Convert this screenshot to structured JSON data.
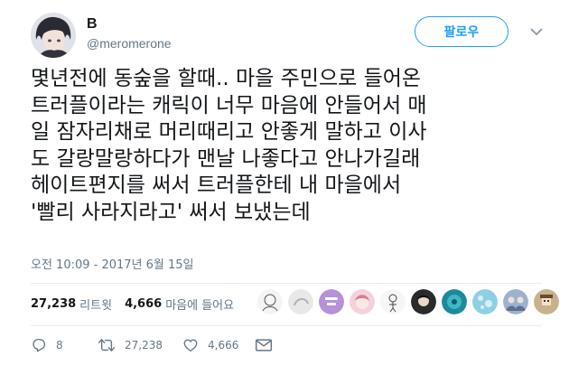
{
  "user": {
    "display_name": "B",
    "handle": "@meromerone",
    "avatar_icon": "anime-character-avatar"
  },
  "follow_button_label": "팔로우",
  "tweet": {
    "lines": [
      "몇년전에 동숲을 할때.. 마을 주민으로 들어온",
      "트러플이라는 캐릭이 너무 마음에 안들어서 매",
      "일 잠자리채로 머리때리고 안좋게 말하고 이사",
      "도 갈랑말랑하다가 맨날 나좋다고 안나가길래",
      "헤이트편지를 써서 트러플한테 내 마을에서",
      "'빨리 사라지라고' 써서 보냈는데"
    ],
    "timestamp": "오전 10:09 - 2017년 6월 15일"
  },
  "stats": {
    "retweets_count": "27,238",
    "retweets_label": "리트윗",
    "likes_count": "4,666",
    "likes_label": "마음에 들어요"
  },
  "likers": [
    {
      "icon": "sketch-avatar",
      "color": "#f4f4f4"
    },
    {
      "icon": "gray-sketch-avatar",
      "color": "#e8e8e8"
    },
    {
      "icon": "text-logo-avatar",
      "color": "#b690d8"
    },
    {
      "icon": "pink-anime-avatar",
      "color": "#f3d2dc"
    },
    {
      "icon": "doodle-avatar",
      "color": "#f6f6f6"
    },
    {
      "icon": "dark-character-avatar",
      "color": "#2b2b2b"
    },
    {
      "icon": "teal-avatar",
      "color": "#1d8a9a"
    },
    {
      "icon": "blue-pattern-avatar",
      "color": "#8fcfe4"
    },
    {
      "icon": "group-avatar",
      "color": "#9bb2cf"
    },
    {
      "icon": "pixel-avatar",
      "color": "#c9b18f"
    }
  ],
  "actions": {
    "reply_count": "8",
    "retweet_count": "27,238",
    "like_count": "4,666"
  },
  "colors": {
    "accent": "#1da1f2",
    "text": "#14171a",
    "secondary": "#657786",
    "divider": "#e6ecf0"
  }
}
